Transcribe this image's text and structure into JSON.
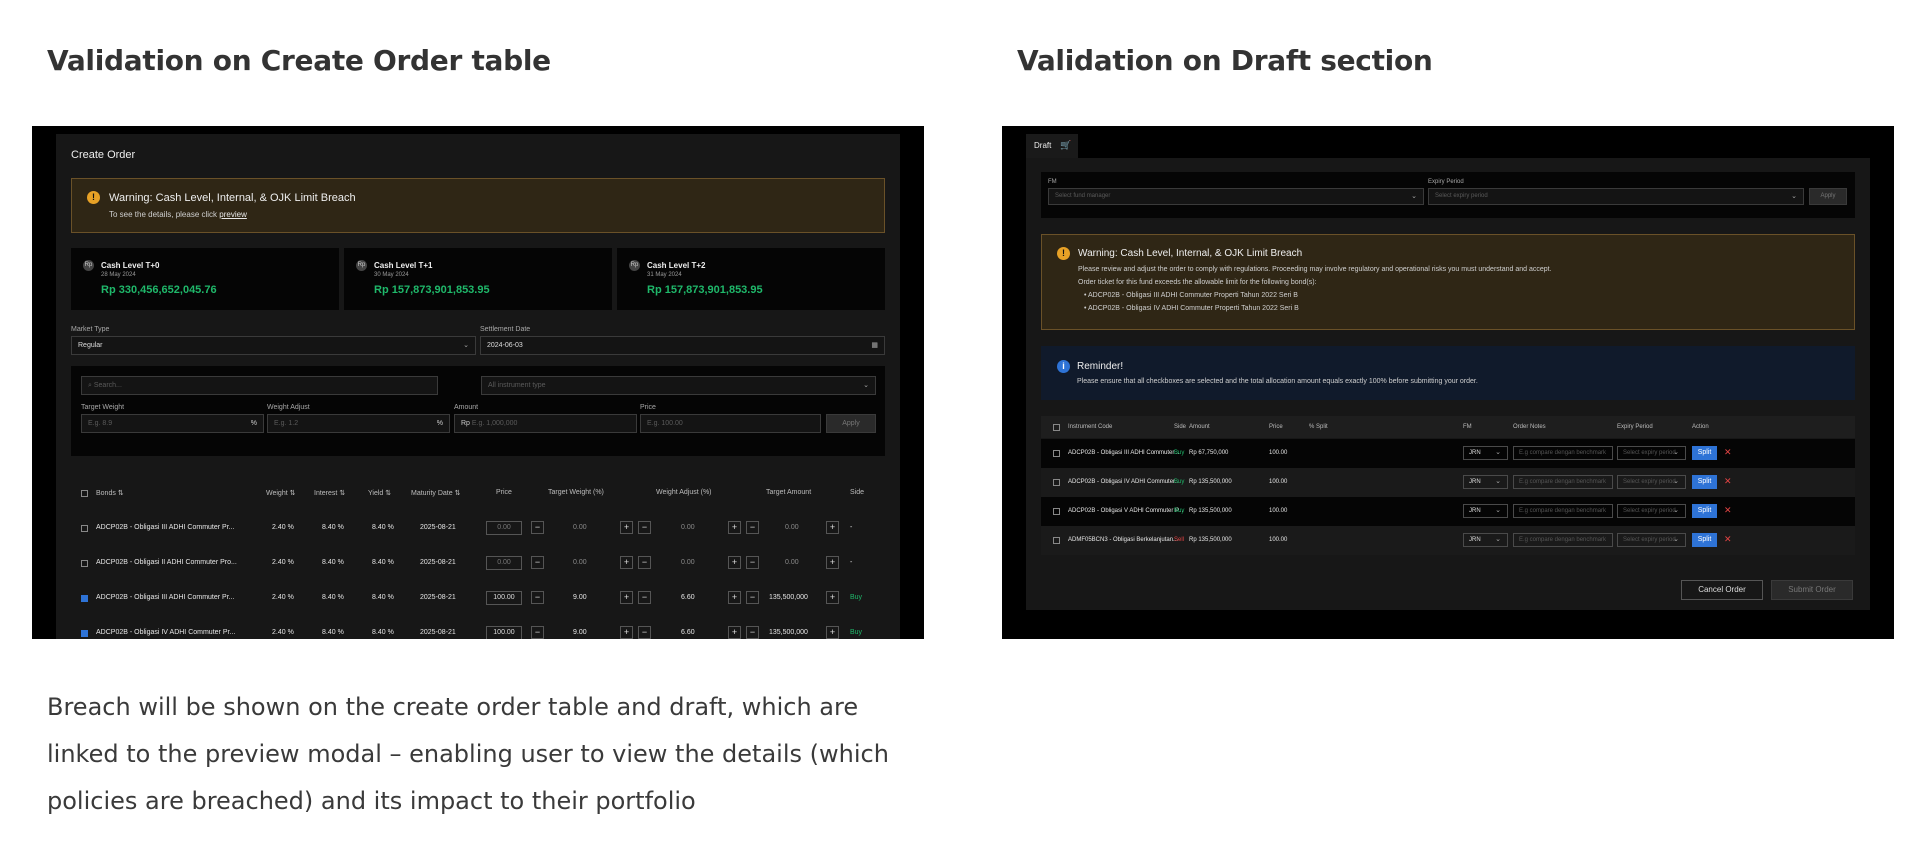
{
  "headings": {
    "left": "Validation on Create Order table",
    "right": "Validation on Draft section"
  },
  "caption": "Breach will be shown on the create order table and draft, which are linked to the preview modal – enabling user to view the details (which policies are breached) and its impact to their portfolio",
  "create_order": {
    "title": "Create Order",
    "warning": {
      "title": "Warning: Cash Level, Internal, & OJK Limit Breach",
      "sub_prefix": "To see the details, please click ",
      "link": "preview"
    },
    "cash_cards": [
      {
        "label": "Cash Level T+0",
        "date": "28 May 2024",
        "value": "Rp 330,456,652,045.76"
      },
      {
        "label": "Cash Level T+1",
        "date": "30 May 2024",
        "value": "Rp 157,873,901,853.95"
      },
      {
        "label": "Cash Level T+2",
        "date": "31 May 2024",
        "value": "Rp 157,873,901,853.95"
      }
    ],
    "market_type_label": "Market Type",
    "market_type_value": "Regular",
    "settlement_label": "Settlement Date",
    "settlement_value": "2024-06-03",
    "search_placeholder": "Search...",
    "instrument_placeholder": "All instrument type",
    "target_weight_label": "Target Weight",
    "target_weight_placeholder": "E.g. 8.9",
    "weight_adjust_label": "Weight Adjust",
    "weight_adjust_placeholder": "E.g. 1.2",
    "amount_label": "Amount",
    "amount_prefix": "Rp",
    "amount_placeholder": "E.g. 1,000,000",
    "price_label": "Price",
    "price_placeholder": "E.g. 100.00",
    "apply_label": "Apply",
    "percent": "%",
    "columns": [
      "Bonds",
      "Weight",
      "Interest",
      "Yield",
      "Maturity Date",
      "Price",
      "Target Weight (%)",
      "Weight Adjust (%)",
      "Target Amount",
      "Side"
    ],
    "rows": [
      {
        "checked": false,
        "bond": "ADCP02B - Obligasi III ADHI Commuter Pr...",
        "weight": "2.40 %",
        "interest": "8.40 %",
        "yield": "8.40 %",
        "maturity": "2025-08-21",
        "price": "0.00",
        "target_weight": "0.00",
        "weight_adjust": "0.00",
        "target_amount": "0.00",
        "side": "-"
      },
      {
        "checked": false,
        "bond": "ADCP02B - Obligasi II ADHI Commuter Pro...",
        "weight": "2.40 %",
        "interest": "8.40 %",
        "yield": "8.40 %",
        "maturity": "2025-08-21",
        "price": "0.00",
        "target_weight": "0.00",
        "weight_adjust": "0.00",
        "target_amount": "0.00",
        "side": "-"
      },
      {
        "checked": true,
        "bond": "ADCP02B - Obligasi III ADHI Commuter Pr...",
        "weight": "2.40 %",
        "interest": "8.40 %",
        "yield": "8.40 %",
        "maturity": "2025-08-21",
        "price": "100.00",
        "target_weight": "9.00",
        "weight_adjust": "6.60",
        "target_amount": "135,500,000",
        "side": "Buy"
      },
      {
        "checked": true,
        "bond": "ADCP02B - Obligasi IV ADHI Commuter Pr...",
        "weight": "2.40 %",
        "interest": "8.40 %",
        "yield": "8.40 %",
        "maturity": "2025-08-21",
        "price": "100.00",
        "target_weight": "9.00",
        "weight_adjust": "6.60",
        "target_amount": "135,500,000",
        "side": "Buy"
      }
    ]
  },
  "draft": {
    "tab_label": "Draft",
    "fm_label": "FM",
    "fm_placeholder": "Select fund manager",
    "expiry_label": "Expiry Period",
    "expiry_placeholder": "Select expiry period",
    "apply_label": "Apply",
    "warning": {
      "title": "Warning: Cash Level, Internal, & OJK Limit Breach",
      "line1": "Please review and adjust the order to comply with regulations. Proceeding may involve regulatory and operational risks you must understand and accept.",
      "line2": "Order ticket for this fund exceeds the allowable limit for the following bond(s):",
      "bullets": [
        "ADCP02B - Obligasi III ADHI Commuter Properti Tahun 2022 Seri B",
        "ADCP02B - Obligasi IV ADHI Commuter Properti Tahun 2022 Seri B"
      ]
    },
    "reminder": {
      "title": "Reminder!",
      "text": "Please ensure that all checkboxes are selected and the total allocation amount equals exactly 100% before submitting your order."
    },
    "columns": [
      "Instrument Code",
      "Side",
      "Amount",
      "Price",
      "% Split",
      "FM",
      "Order Notes",
      "Expiry Period",
      "Action"
    ],
    "notes_placeholder": "E.g compare dengan benchmark",
    "expiry_row_placeholder": "Select expiry period",
    "split_label": "Split",
    "rows": [
      {
        "code": "ADCP02B - Obligasi III ADHI Commuter...",
        "side": "Buy",
        "amount": "Rp 67,750,000",
        "price": "100.00",
        "fm": "JRN"
      },
      {
        "code": "ADCP02B - Obligasi IV ADHI Commuter...",
        "side": "Buy",
        "amount": "Rp 135,500,000",
        "price": "100.00",
        "fm": "JRN"
      },
      {
        "code": "ADCP02B - Obligasi V ADHI Commuter P...",
        "side": "Buy",
        "amount": "Rp 135,500,000",
        "price": "100.00",
        "fm": "JRN"
      },
      {
        "code": "ADMF05BCN3 - Obligasi Berkelanjutan...",
        "side": "Sell",
        "amount": "Rp 135,500,000",
        "price": "100.00",
        "fm": "JRN"
      }
    ],
    "cancel_label": "Cancel Order",
    "submit_label": "Submit Order"
  },
  "colors": {
    "warning": "#e7a126",
    "positive": "#1fb86a",
    "negative": "#e44444",
    "primary": "#2e73d6"
  }
}
